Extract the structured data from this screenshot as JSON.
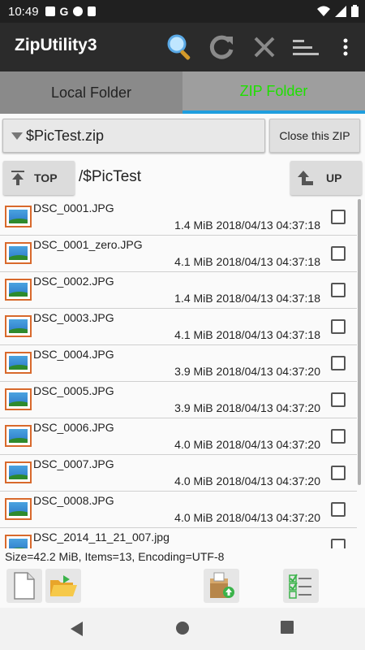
{
  "status_bar": {
    "time": "10:49"
  },
  "app_bar": {
    "title": "ZipUtility3"
  },
  "tabs": [
    {
      "label": "Local Folder"
    },
    {
      "label": "ZIP Folder"
    }
  ],
  "zip": {
    "selected": "$PicTest.zip",
    "close_label": "Close this ZIP"
  },
  "nav": {
    "top_label": "TOP",
    "path": "/$PicTest",
    "up_label": "UP"
  },
  "files": [
    {
      "name": "DSC_0001.JPG",
      "size": "1.4 MiB",
      "date": "2018/04/13",
      "time": "04:37:18"
    },
    {
      "name": "DSC_0001_zero.JPG",
      "size": "4.1 MiB",
      "date": "2018/04/13",
      "time": "04:37:18"
    },
    {
      "name": "DSC_0002.JPG",
      "size": "1.4 MiB",
      "date": "2018/04/13",
      "time": "04:37:18"
    },
    {
      "name": "DSC_0003.JPG",
      "size": "4.1 MiB",
      "date": "2018/04/13",
      "time": "04:37:18"
    },
    {
      "name": "DSC_0004.JPG",
      "size": "3.9 MiB",
      "date": "2018/04/13",
      "time": "04:37:20"
    },
    {
      "name": "DSC_0005.JPG",
      "size": "3.9 MiB",
      "date": "2018/04/13",
      "time": "04:37:20"
    },
    {
      "name": "DSC_0006.JPG",
      "size": "4.0 MiB",
      "date": "2018/04/13",
      "time": "04:37:20"
    },
    {
      "name": "DSC_0007.JPG",
      "size": "4.0 MiB",
      "date": "2018/04/13",
      "time": "04:37:20"
    },
    {
      "name": "DSC_0008.JPG",
      "size": "4.0 MiB",
      "date": "2018/04/13",
      "time": "04:37:20"
    },
    {
      "name": "DSC_2014_11_21_007.jpg",
      "size": "",
      "date": "",
      "time": ""
    }
  ],
  "info": "Size=42.2 MiB, Items=13, Encoding=UTF-8",
  "colors": {
    "accent_green": "#1ee000",
    "tab_underline": "#1f9ede",
    "app_bar": "#2b2b2b",
    "thumb_border": "#d8692c"
  }
}
